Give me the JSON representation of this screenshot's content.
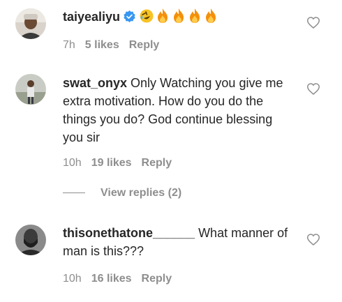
{
  "comments": [
    {
      "username": "taiyealiyu",
      "verified": true,
      "text": "",
      "emojis": [
        "rolling-laughing-emoji",
        "fire-emoji",
        "fire-emoji",
        "fire-emoji",
        "fire-emoji"
      ],
      "time": "7h",
      "likes": "5 likes",
      "reply": "Reply"
    },
    {
      "username": "swat_onyx",
      "verified": false,
      "text": "Only Watching you give me extra motivation. How do you do the things you do? God continue blessing you sir",
      "time": "10h",
      "likes": "19 likes",
      "reply": "Reply",
      "view_replies": "View replies (2)"
    },
    {
      "username": "thisonethatone______",
      "verified": false,
      "text": "What manner of man is this???",
      "time": "10h",
      "likes": "16 likes",
      "reply": "Reply"
    }
  ],
  "colors": {
    "text": "#262626",
    "muted": "#8e8e8e",
    "verified": "#3897f0",
    "heart": "#8e8e8e"
  }
}
